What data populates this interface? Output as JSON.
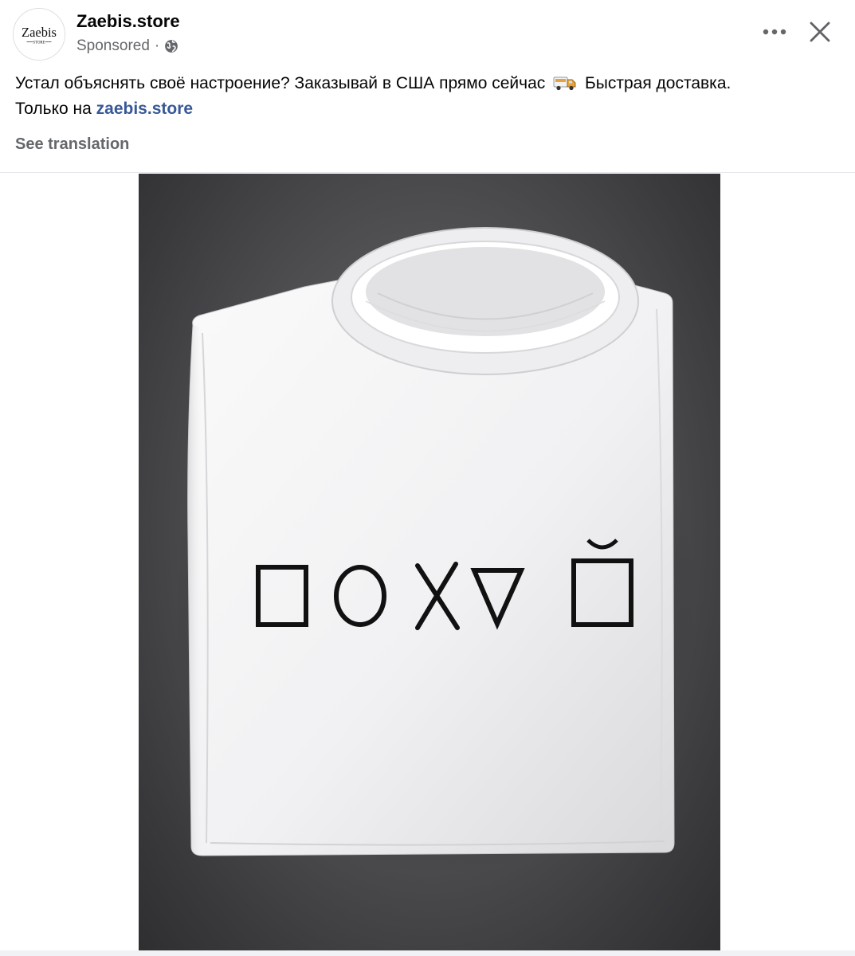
{
  "post": {
    "page_name": "Zaebis.store",
    "sponsored_label": "Sponsored",
    "separator": "·",
    "avatar_logo_text": "Zaebis",
    "avatar_logo_sub": "STORE",
    "caption": {
      "part1": "Устал объяснять своё настроение? Заказывай в США прямо сейчас",
      "part2": "Быстрая доставка.",
      "part3": "Только на",
      "link_text": "zaebis.store"
    },
    "see_translation_label": "See translation",
    "icons": {
      "more": "more-horizontal-icon",
      "close": "close-icon",
      "audience": "globe-icon",
      "emoji": "delivery-truck-icon"
    },
    "colors": {
      "link": "#385898",
      "secondary_text": "#65676b",
      "primary_text": "#050505"
    }
  }
}
